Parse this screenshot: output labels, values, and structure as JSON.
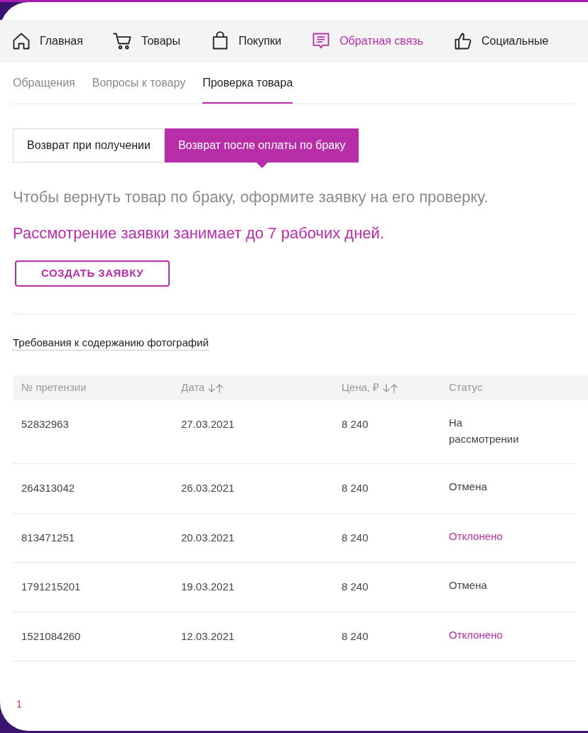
{
  "nav": [
    {
      "label": "Главная",
      "selected": false
    },
    {
      "label": "Товары",
      "selected": false
    },
    {
      "label": "Покупки",
      "selected": false
    },
    {
      "label": "Обратная связь",
      "selected": true
    },
    {
      "label": "Социальные",
      "selected": false
    }
  ],
  "subtabs": [
    {
      "label": "Обращения",
      "selected": false
    },
    {
      "label": "Вопросы к товару",
      "selected": false
    },
    {
      "label": "Проверка товара",
      "selected": true
    }
  ],
  "segments": [
    {
      "label": "Возврат при получении",
      "selected": false
    },
    {
      "label": "Возврат после оплаты по браку",
      "selected": true
    }
  ],
  "intro": "Чтобы вернуть товар по браку, оформите заявку на его проверку.",
  "notice": "Рассмотрение заявки занимает до 7 рабочих дней.",
  "create_button": "СОЗДАТЬ ЗАЯВКУ",
  "photo_requirements_link": "Требования к содержанию фотографий",
  "table": {
    "columns": [
      {
        "label": "№ претензии",
        "sortable": false
      },
      {
        "label": "Дата",
        "sortable": true
      },
      {
        "label": "Цена, ₽",
        "sortable": true
      },
      {
        "label": "Статус",
        "sortable": false
      }
    ],
    "rows": [
      {
        "number": "52832963",
        "date": "27.03.2021",
        "price": "8 240",
        "status": "На рассмотрении",
        "kind": "neutral"
      },
      {
        "number": "264313042",
        "date": "26.03.2021",
        "price": "8 240",
        "status": "Отмена",
        "kind": "neutral"
      },
      {
        "number": "813471251",
        "date": "20.03.2021",
        "price": "8 240",
        "status": "Отклонено",
        "kind": "rejected"
      },
      {
        "number": "1791215201",
        "date": "19.03.2021",
        "price": "8 240",
        "status": "Отмена",
        "kind": "neutral"
      },
      {
        "number": "1521084260",
        "date": "12.03.2021",
        "price": "8 240",
        "status": "Отклонено",
        "kind": "rejected"
      }
    ]
  },
  "pagination": [
    {
      "label": "1",
      "selected": true
    }
  ]
}
